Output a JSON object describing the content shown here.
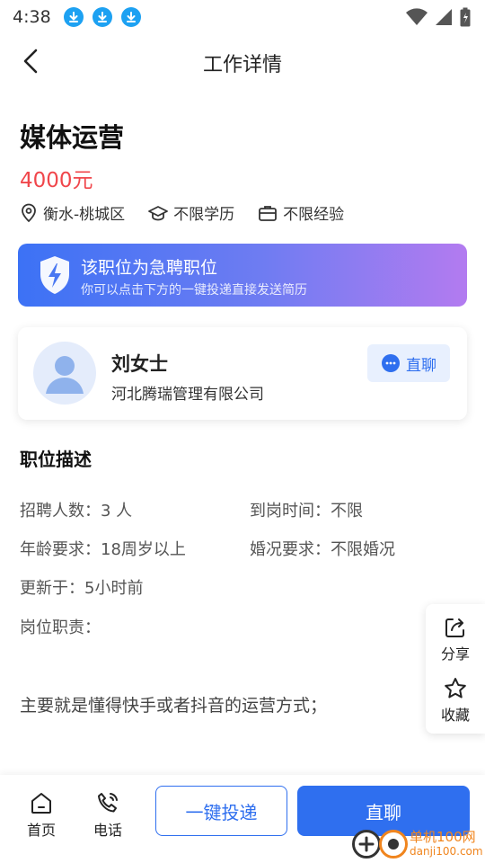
{
  "status_bar": {
    "time": "4:38",
    "icons": [
      "download-icon",
      "download-icon",
      "download-icon",
      "wifi-icon",
      "signal-icon",
      "battery-icon"
    ]
  },
  "nav": {
    "title": "工作详情",
    "back_icon": "chevron-left-icon"
  },
  "job": {
    "title": "媒体运营",
    "salary": "4000元",
    "location": "衡水-桃城区",
    "education": "不限学历",
    "experience": "不限经验"
  },
  "urgent": {
    "title": "该职位为急聘职位",
    "subtitle": "你可以点击下方的一键投递直接发送简历",
    "icon": "shield-bolt-icon"
  },
  "recruiter": {
    "name": "刘女士",
    "company": "河北腾瑞管理有限公司",
    "chat_label": "直聊"
  },
  "description": {
    "section_title": "职位描述",
    "headcount_label": "招聘人数：",
    "headcount_value": "3 人",
    "arrival_label": "到岗时间：",
    "arrival_value": "不限",
    "age_label": "年龄要求：",
    "age_value": "18周岁以上",
    "marital_label": "婚况要求：",
    "marital_value": "不限婚况",
    "updated_label": "更新于：",
    "updated_value": "5小时前",
    "duties_label": "岗位职责：",
    "duties_text": "主要就是懂得快手或者抖音的运营方式；"
  },
  "side_actions": {
    "share_label": "分享",
    "favorite_label": "收藏"
  },
  "bottom_bar": {
    "home_label": "首页",
    "phone_label": "电话",
    "apply_label": "一键投递",
    "talk_label": "直聊"
  },
  "watermark": {
    "line1": "单机100网",
    "line2": "danji100.com"
  },
  "colors": {
    "accent": "#2f6fef",
    "salary": "#f0464b",
    "status_download": "#1da1f2"
  }
}
